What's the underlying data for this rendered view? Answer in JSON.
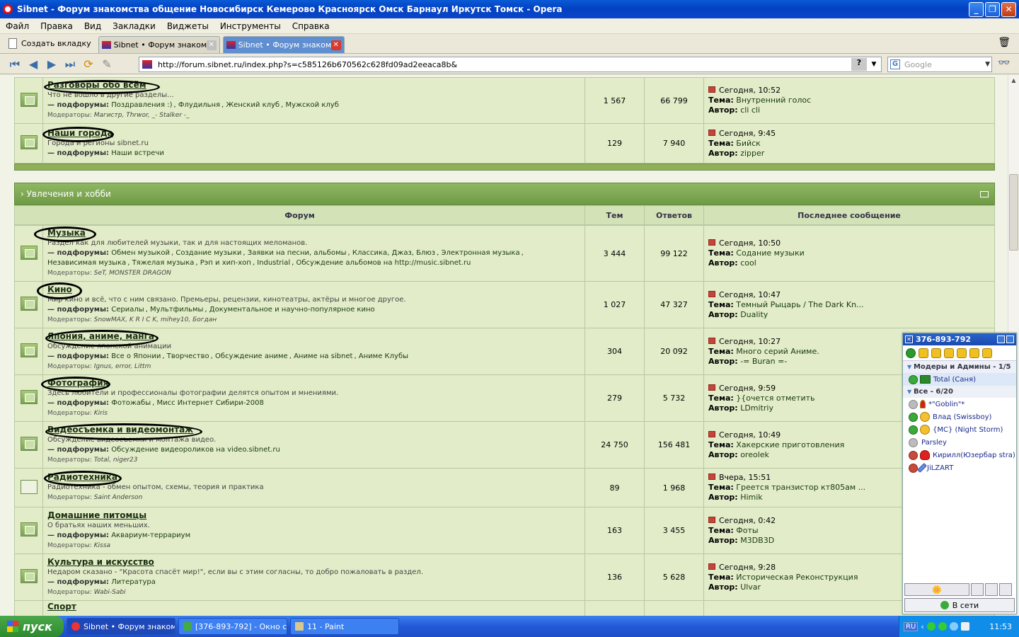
{
  "window": {
    "title": "Sibnet - Форум знакомства общение Новосибирск Кемерово Красноярск Омск Барнаул Иркутск Томск - Opera"
  },
  "menu": [
    "Файл",
    "Правка",
    "Вид",
    "Закладки",
    "Виджеты",
    "Инструменты",
    "Справка"
  ],
  "tabs": {
    "new_tab": "Создать вкладку",
    "items": [
      {
        "label": "Sibnet • Форум знаком..."
      },
      {
        "label": "Sibnet • Форум знаком..."
      }
    ]
  },
  "address": {
    "url": "http://forum.sibnet.ru/index.php?s=c585126b670562c628fd09ad2eeaca8b&",
    "help": "?",
    "search_placeholder": "Google"
  },
  "forum": {
    "top_rows": [
      {
        "title": "Разговоры обо всём",
        "desc": "Что не вошло в другие разделы...",
        "subs_label": "— подфорумы:",
        "subs": [
          "Поздравления :)",
          "Флудильня",
          "Женский клуб",
          "Мужской клуб"
        ],
        "mods_label": "Модераторы:",
        "mods": [
          "Магистр",
          "Thrwor",
          "_- Stalker -_"
        ],
        "topics": "1 567",
        "replies": "66 799",
        "last_date": "Сегодня, 10:52",
        "last_topic_label": "Тема:",
        "last_topic": "Внутренний голос",
        "last_author_label": "Автор:",
        "last_author": "cli cli"
      },
      {
        "title": "Наши города",
        "desc": "Города и регионы sibnet.ru",
        "subs_label": "— подфорумы:",
        "subs": [
          "Наши встречи"
        ],
        "mods_label": "",
        "mods": [],
        "topics": "129",
        "replies": "7 940",
        "last_date": "Сегодня, 9:45",
        "last_topic_label": "Тема:",
        "last_topic": "Бийск",
        "last_author_label": "Автор:",
        "last_author": "zipper"
      }
    ],
    "category": {
      "title": "› Увлечения и хобби",
      "col_forum": "Форум",
      "col_topics": "Тем",
      "col_replies": "Ответов",
      "col_last": "Последнее сообщение"
    },
    "rows": [
      {
        "title": "Музыка",
        "desc": "Раздел как для любителей музыки, так и для настоящих меломанов.",
        "subs_label": "— подфорумы:",
        "subs": [
          "Обмен музыкой",
          "Создание музыки",
          "Заявки на песни, альбомы",
          "Классика, Джаз, Блюз",
          "Электронная музыка",
          "Независимая музыка",
          "Тяжелая музыка",
          "Рэп и хип-хоп",
          "Industrial",
          "Обсуждение альбомов на http://music.sibnet.ru"
        ],
        "mods_label": "Модераторы:",
        "mods": [
          "SeT",
          "MONSTER DRAGON"
        ],
        "topics": "3 444",
        "replies": "99 122",
        "last_date": "Сегодня, 10:50",
        "last_topic_label": "Тема:",
        "last_topic": " Содание музыки",
        "last_author_label": "Автор:",
        "last_author": "cool"
      },
      {
        "title": "Кино",
        "desc": "Мир кино и всё, что с ним связано. Премьеры, рецензии, кинотеатры, актёры и многое другое.",
        "subs_label": "— подфорумы:",
        "subs": [
          "Сериалы",
          "Мультфильмы",
          "Документальное и научно-популярное кино"
        ],
        "mods_label": "Модераторы:",
        "mods": [
          "SnowMAX",
          "K R I C K",
          "mihey10",
          "Богдан"
        ],
        "topics": "1 027",
        "replies": "47 327",
        "last_date": "Сегодня, 10:47",
        "last_topic_label": "Тема:",
        "last_topic": "Темный Рыцарь / The Dark Kn...",
        "last_author_label": "Автор:",
        "last_author": "Duality"
      },
      {
        "title": "Япония, аниме, манга",
        "desc": "Обсуждение японской анимации",
        "subs_label": "— подфорумы:",
        "subs": [
          "Все о Японии",
          "Творчество",
          "Обсуждение аниме",
          "Аниме на sibnet",
          "Аниме Клубы"
        ],
        "mods_label": "Модераторы:",
        "mods": [
          "Ignus",
          "error",
          "Littm"
        ],
        "topics": "304",
        "replies": "20 092",
        "last_date": "Сегодня, 10:27",
        "last_topic_label": "Тема:",
        "last_topic": "Много серий Аниме.",
        "last_author_label": "Автор:",
        "last_author": "-= Buran =-"
      },
      {
        "title": "Фотография",
        "desc": "Здесь любители и профессионалы фотографии делятся опытом и мнениями.",
        "subs_label": "— подфорумы:",
        "subs": [
          "Фотожабы",
          "Мисс Интернет Сибири-2008"
        ],
        "mods_label": "Модераторы:",
        "mods": [
          "Kiris"
        ],
        "topics": "279",
        "replies": "5 732",
        "last_date": "Сегодня, 9:59",
        "last_topic_label": "Тема:",
        "last_topic": "}{очется отметить",
        "last_author_label": "Автор:",
        "last_author": "LDmitriy"
      },
      {
        "title": "Видеосъемка и видеомонтаж",
        "desc": "Обсуждение видеосъемки и монтажа видео.",
        "subs_label": "— подфорумы:",
        "subs": [
          "Обсуждение видеороликов на video.sibnet.ru"
        ],
        "mods_label": "Модераторы:",
        "mods": [
          "Total",
          "niger23"
        ],
        "topics": "24 750",
        "replies": "156 481",
        "last_date": "Сегодня, 10:49",
        "last_topic_label": "Тема:",
        "last_topic": "Хакерские приготовления",
        "last_author_label": "Автор:",
        "last_author": "oreolek"
      },
      {
        "title": "Радиотехника",
        "desc": "Радиотехника - обмен опытом, схемы, теория и практика",
        "subs_label": "",
        "subs": [],
        "mods_label": "Модераторы:",
        "mods": [
          "Saint Anderson"
        ],
        "topics": "89",
        "replies": "1 968",
        "last_date": "Вчера, 15:51",
        "last_topic_label": "Тема:",
        "last_topic": "Греется транзистор кт805ам ...",
        "last_author_label": "Автор:",
        "last_author": "Himik"
      },
      {
        "title": "Домашние питомцы",
        "desc": "О братьях наших меньших.",
        "subs_label": "— подфорумы:",
        "subs": [
          "Аквариум-террариум"
        ],
        "mods_label": "Модераторы:",
        "mods": [
          "Kissa"
        ],
        "topics": "163",
        "replies": "3 455",
        "last_date": "Сегодня, 0:42",
        "last_topic_label": "Тема:",
        "last_topic": "Фоты",
        "last_author_label": "Автор:",
        "last_author": "M3DB3D"
      },
      {
        "title": "Культура и искусство",
        "desc": "Недаром сказано - \"Красота спасёт мир!\", если вы с этим согласны, то добро пожаловать в раздел.",
        "subs_label": "— подфорумы:",
        "subs": [
          "Литература"
        ],
        "mods_label": "Модераторы:",
        "mods": [
          "Wabi-Sabi"
        ],
        "topics": "136",
        "replies": "5 628",
        "last_date": "Сегодня, 9:28",
        "last_topic_label": "Тема:",
        "last_topic": "Историческая Реконструкция",
        "last_author_label": "Автор:",
        "last_author": "Ulvar"
      },
      {
        "title": "Спорт",
        "desc": "",
        "subs_label": "",
        "subs": [],
        "mods_label": "",
        "mods": [],
        "topics": "",
        "replies": "",
        "last_date": "",
        "last_topic_label": "",
        "last_topic": "",
        "last_author_label": "",
        "last_author": ""
      }
    ]
  },
  "icq": {
    "uin": "376-893-792",
    "group1": "Модеры и Админы - 1/5",
    "group1_contacts": [
      {
        "name": "Total (Саня)"
      }
    ],
    "group2": "Все - 6/20",
    "group2_contacts": [
      {
        "name": "*\"Goblin\"*"
      },
      {
        "name": "Влад (Swissboy)"
      },
      {
        "name": "{MC} (Night Storm)"
      },
      {
        "name": "Parsley"
      },
      {
        "name": "Кирилл(Юзербар stra)"
      },
      {
        "name": "JiLZART"
      }
    ],
    "status": "В сети"
  },
  "taskbar": {
    "start": "пуск",
    "items": [
      {
        "label": "Sibnet • Форум знаком..."
      },
      {
        "label": "[376-893-792] - Окно с..."
      },
      {
        "label": "11 - Paint"
      }
    ],
    "lang": "RU",
    "clock": "11:53"
  }
}
